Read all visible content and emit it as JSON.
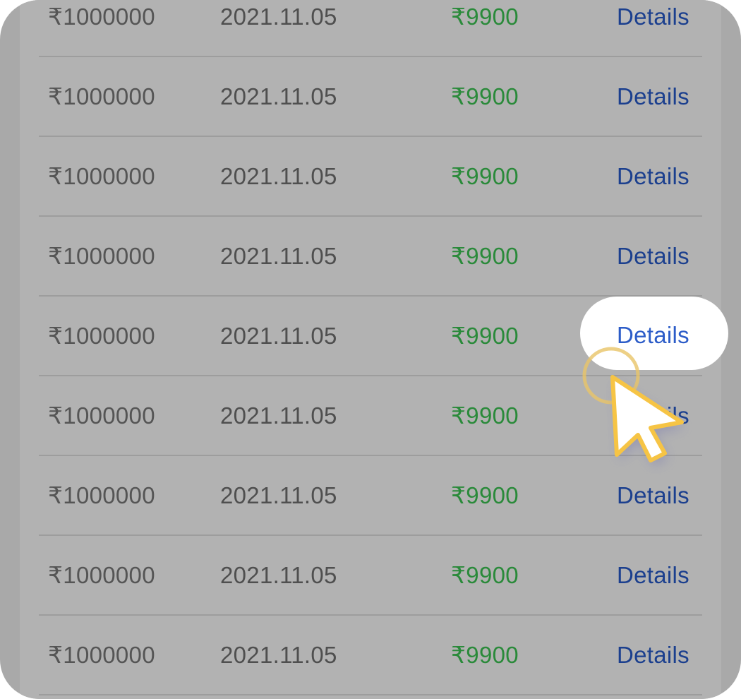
{
  "rows": [
    {
      "amount": "₹1000000",
      "date": "2021.11.05",
      "fee": "₹9900",
      "action": "Details"
    },
    {
      "amount": "₹1000000",
      "date": "2021.11.05",
      "fee": "₹9900",
      "action": "Details"
    },
    {
      "amount": "₹1000000",
      "date": "2021.11.05",
      "fee": "₹9900",
      "action": "Details"
    },
    {
      "amount": "₹1000000",
      "date": "2021.11.05",
      "fee": "₹9900",
      "action": "Details"
    },
    {
      "amount": "₹1000000",
      "date": "2021.11.05",
      "fee": "₹9900",
      "action": "Details"
    },
    {
      "amount": "₹1000000",
      "date": "2021.11.05",
      "fee": "₹9900",
      "action": "Details"
    },
    {
      "amount": "₹1000000",
      "date": "2021.11.05",
      "fee": "₹9900",
      "action": "Details"
    },
    {
      "amount": "₹1000000",
      "date": "2021.11.05",
      "fee": "₹9900",
      "action": "Details"
    },
    {
      "amount": "₹1000000",
      "date": "2021.11.05",
      "fee": "₹9900",
      "action": "Details"
    }
  ],
  "highlighted": {
    "label": "Details",
    "row_index": 4
  },
  "colors": {
    "amount": "#555555",
    "date": "#4f4f4f",
    "fee": "#2a8a3a",
    "details": "#1b3f8e",
    "highlight_text": "#2c5cc8",
    "pointer": "#f6c445"
  },
  "icons": {
    "cursor": "pointer-arrow-icon"
  }
}
